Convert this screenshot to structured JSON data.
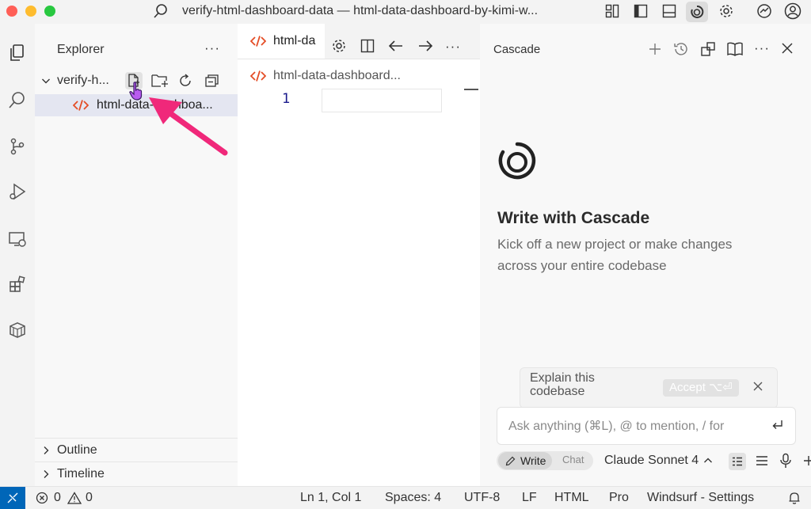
{
  "window": {
    "title": "verify-html-dashboard-data — html-data-dashboard-by-kimi-w..."
  },
  "explorer": {
    "header": "Explorer",
    "more": "···",
    "folder": {
      "name": "verify-h..."
    },
    "files": [
      {
        "name": "html-data-dashboa..."
      }
    ],
    "sections": [
      {
        "label": "Outline"
      },
      {
        "label": "Timeline"
      }
    ]
  },
  "editor": {
    "tab": {
      "label": "html-da"
    },
    "breadcrumb": "html-data-dashboard...",
    "line_number": "1",
    "more": "···"
  },
  "cascade": {
    "title": "Cascade",
    "heading": "Write with Cascade",
    "subtitle_line1": "Kick off a new project or make changes",
    "subtitle_line2": "across your entire codebase",
    "suggestion": {
      "line1": "Explain this",
      "line2": "codebase",
      "accept": "Accept ⌥⏎"
    },
    "input": {
      "placeholder": "Ask anything (⌘L), @ to mention, / for"
    },
    "modes": {
      "write": "Write",
      "chat": "Chat"
    },
    "model": "Claude Sonnet 4",
    "more": "···"
  },
  "statusbar": {
    "errors": "0",
    "warnings": "0",
    "position": "Ln 1, Col 1",
    "spaces": "Spaces: 4",
    "encoding": "UTF-8",
    "eol": "LF",
    "language": "HTML",
    "plan": "Pro",
    "settings": "Windsurf - Settings"
  },
  "colors": {
    "accent_blue": "#0066b8",
    "html_icon": "#e44d26",
    "annotation_arrow": "#f0287a"
  }
}
